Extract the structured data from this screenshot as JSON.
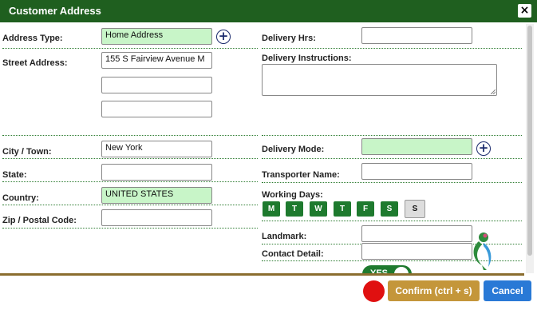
{
  "dialog": {
    "title": "Customer Address",
    "close_icon": "×"
  },
  "left": {
    "address_type": {
      "label": "Address Type:",
      "value": "Home Address"
    },
    "street_address": {
      "label": "Street Address:",
      "line1": "155 S Fairview Avenue  M",
      "line2": "",
      "line3": ""
    },
    "city": {
      "label": "City / Town:",
      "value": "New York"
    },
    "state": {
      "label": "State:",
      "value": ""
    },
    "country": {
      "label": "Country:",
      "value": "UNITED STATES"
    },
    "zip": {
      "label": "Zip / Postal Code:",
      "value": ""
    }
  },
  "right": {
    "delivery_hrs": {
      "label": "Delivery Hrs:",
      "value": ""
    },
    "delivery_instructions": {
      "label": "Delivery Instructions:",
      "value": ""
    },
    "delivery_mode": {
      "label": "Delivery Mode:",
      "value": ""
    },
    "transporter_name": {
      "label": "Transporter Name:",
      "value": ""
    },
    "working_days": {
      "label": "Working Days:",
      "days": [
        {
          "label": "M",
          "selected": true
        },
        {
          "label": "T",
          "selected": true
        },
        {
          "label": "W",
          "selected": true
        },
        {
          "label": "T",
          "selected": true
        },
        {
          "label": "F",
          "selected": true
        },
        {
          "label": "S",
          "selected": true
        },
        {
          "label": "S",
          "selected": false
        }
      ]
    },
    "landmark": {
      "label": "Landmark:",
      "value": ""
    },
    "contact_detail": {
      "label": "Contact Detail:",
      "value": ""
    },
    "toggle": {
      "label": "YES",
      "on": true
    }
  },
  "footer": {
    "confirm_label": "Confirm (ctrl + s)",
    "cancel_label": "Cancel"
  },
  "colors": {
    "header": "#1f5f1f",
    "field_highlight": "#c8f5c8",
    "day_on": "#1e7a2e",
    "confirm": "#c4963a",
    "cancel": "#2979d6",
    "record": "#e01010"
  },
  "icons": {
    "add": "plus-circle-icon",
    "close": "close-icon",
    "logo": "brand-logo-icon"
  }
}
